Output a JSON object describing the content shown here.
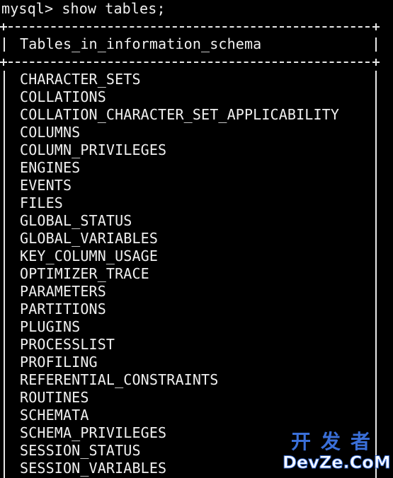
{
  "prompt": "mysql> show tables;",
  "table": {
    "header": "Tables_in_information_schema",
    "rows": [
      "CHARACTER_SETS",
      "COLLATIONS",
      "COLLATION_CHARACTER_SET_APPLICABILITY",
      "COLUMNS",
      "COLUMN_PRIVILEGES",
      "ENGINES",
      "EVENTS",
      "FILES",
      "GLOBAL_STATUS",
      "GLOBAL_VARIABLES",
      "KEY_COLUMN_USAGE",
      "OPTIMIZER_TRACE",
      "PARAMETERS",
      "PARTITIONS",
      "PLUGINS",
      "PROCESSLIST",
      "PROFILING",
      "REFERENTIAL_CONSTRAINTS",
      "ROUTINES",
      "SCHEMATA",
      "SCHEMA_PRIVILEGES",
      "SESSION_STATUS",
      "SESSION_VARIABLES"
    ]
  },
  "watermark": {
    "cn": "开发者",
    "en": "DevZe.CoM"
  },
  "colors": {
    "background": "#000000",
    "text": "#f0f0f0",
    "watermark": "#3a6fd8"
  }
}
